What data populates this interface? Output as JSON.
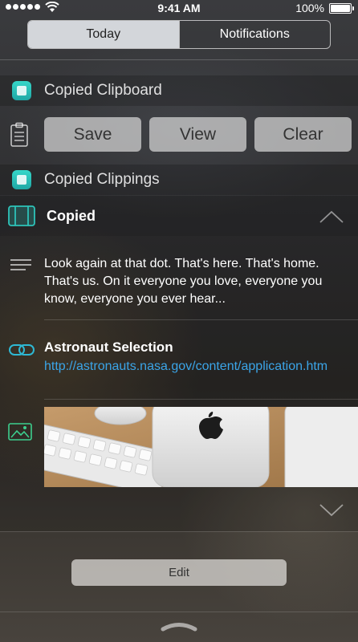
{
  "status_bar": {
    "time": "9:41 AM",
    "battery": "100%"
  },
  "tabs": [
    {
      "label": "Today",
      "selected": true
    },
    {
      "label": "Notifications",
      "selected": false
    }
  ],
  "clipboard_section": {
    "title": "Copied Clipboard",
    "buttons": {
      "save": "Save",
      "view": "View",
      "clear": "Clear"
    }
  },
  "clippings_section": {
    "title": "Copied Clippings",
    "card": {
      "title": "Copied",
      "text_item": "Look again at that dot. That's here. That's home. That's us. On it everyone you love, everyone you know, everyone you ever hear...",
      "link_item": {
        "title": "Astronaut Selection",
        "url": "http://astronauts.nasa.gov/content/application.htm"
      }
    }
  },
  "footer": {
    "edit": "Edit"
  },
  "colors": {
    "accent": "#2ec3b9",
    "link": "#3ba5e8"
  }
}
